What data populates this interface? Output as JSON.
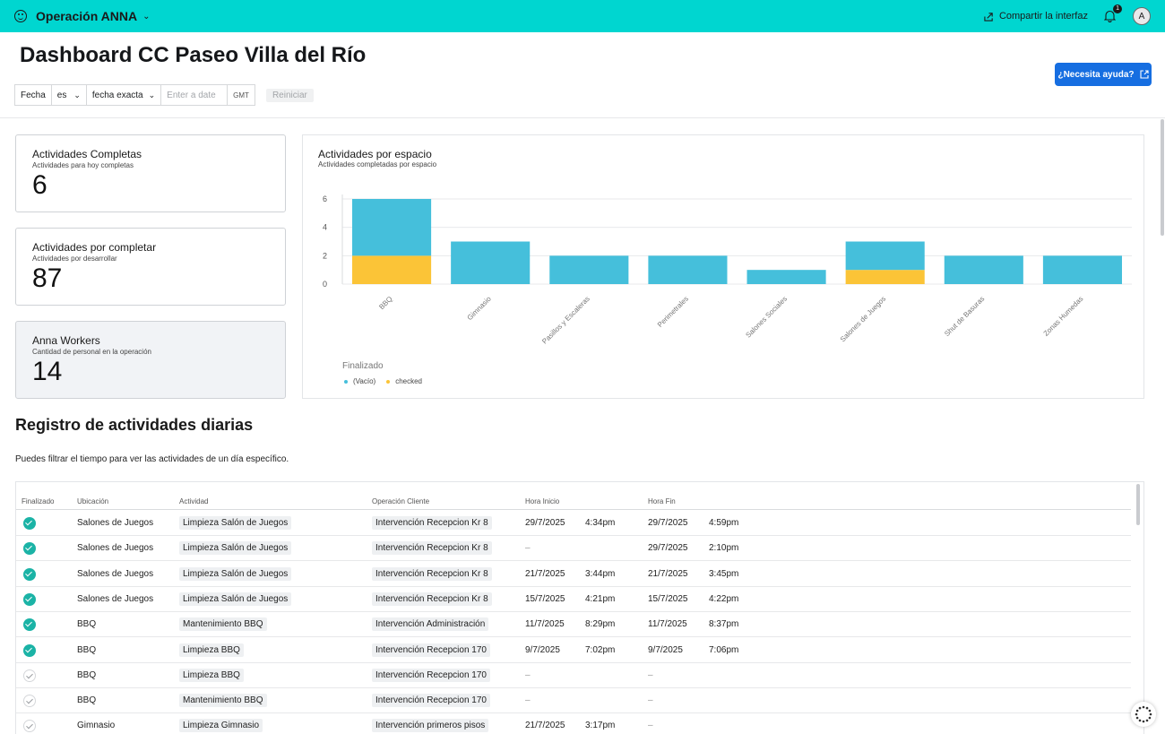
{
  "topbar": {
    "app_name": "Operación ANNA",
    "share_label": "Compartir la interfaz",
    "notification_count": "1",
    "avatar_initial": "A",
    "bg_color": "#00d6d0"
  },
  "page": {
    "title": "Dashboard CC Paseo Villa del Río",
    "help_label": "¿Necesita ayuda?"
  },
  "filters": {
    "field": "Fecha",
    "operator": "es",
    "mode": "fecha exacta",
    "date_placeholder": "Enter a date",
    "timezone": "GMT",
    "reset_label": "Reiniciar"
  },
  "kpis": [
    {
      "title": "Actividades Completas",
      "subtitle": "Actividades para hoy completas",
      "value": "6"
    },
    {
      "title": "Actividades por completar",
      "subtitle": "Actividades por desarrollar",
      "value": "87"
    },
    {
      "title": "Anna Workers",
      "subtitle": "Cantidad de personal en la operación",
      "value": "14"
    }
  ],
  "chart_data": {
    "type": "bar",
    "title": "Actividades por espacio",
    "subtitle": "Actividades completadas por espacio",
    "categories": [
      "BBQ",
      "Gimnasio",
      "Pasillos y Escaleras",
      "Perimetrales",
      "Salones Sociales",
      "Salones de Juegos",
      "Shut de Basuras",
      "Zonas Humedas"
    ],
    "series": [
      {
        "name": "checked",
        "color": "#fbc437",
        "values": [
          2,
          0,
          0,
          0,
          0,
          1,
          0,
          0
        ]
      },
      {
        "name": "(Vacío)",
        "color": "#45bfdb",
        "values": [
          4,
          3,
          2,
          2,
          1,
          2,
          2,
          2
        ]
      }
    ],
    "stacked": true,
    "yticks": [
      "0",
      "2",
      "4",
      "6"
    ],
    "ylim": [
      0,
      6
    ],
    "legend_title": "Finalizado",
    "legend_placement": "bottom-left",
    "grid": true
  },
  "table_section": {
    "title": "Registro de actividades diarias",
    "description": "Puedes filtrar el tiempo para ver las actividades de un día específico.",
    "columns": [
      "Finalizado",
      "Ubicación",
      "Actividad",
      "Operación Cliente",
      "Hora Inicio",
      "Hora Fin"
    ],
    "rows": [
      {
        "done": true,
        "location": "Salones de Juegos",
        "activity": "Limpieza Salón de Juegos",
        "operation": "Intervención Recepcion Kr 8",
        "start_date": "29/7/2025",
        "start_time": "4:34pm",
        "end_date": "29/7/2025",
        "end_time": "4:59pm"
      },
      {
        "done": true,
        "location": "Salones de Juegos",
        "activity": "Limpieza Salón de Juegos",
        "operation": "Intervención Recepcion Kr 8",
        "start_date": "–",
        "start_time": "",
        "end_date": "29/7/2025",
        "end_time": "2:10pm"
      },
      {
        "done": true,
        "location": "Salones de Juegos",
        "activity": "Limpieza Salón de Juegos",
        "operation": "Intervención Recepcion Kr 8",
        "start_date": "21/7/2025",
        "start_time": "3:44pm",
        "end_date": "21/7/2025",
        "end_time": "3:45pm"
      },
      {
        "done": true,
        "location": "Salones de Juegos",
        "activity": "Limpieza Salón de Juegos",
        "operation": "Intervención Recepcion Kr 8",
        "start_date": "15/7/2025",
        "start_time": "4:21pm",
        "end_date": "15/7/2025",
        "end_time": "4:22pm"
      },
      {
        "done": true,
        "location": "BBQ",
        "activity": "Mantenimiento BBQ",
        "operation": "Intervención Administración",
        "start_date": "11/7/2025",
        "start_time": "8:29pm",
        "end_date": "11/7/2025",
        "end_time": "8:37pm"
      },
      {
        "done": true,
        "location": "BBQ",
        "activity": "Limpieza BBQ",
        "operation": "Intervención Recepcion 170",
        "start_date": "9/7/2025",
        "start_time": "7:02pm",
        "end_date": "9/7/2025",
        "end_time": "7:06pm"
      },
      {
        "done": false,
        "location": "BBQ",
        "activity": "Limpieza BBQ",
        "operation": "Intervención Recepcion 170",
        "start_date": "–",
        "start_time": "",
        "end_date": "–",
        "end_time": ""
      },
      {
        "done": false,
        "location": "BBQ",
        "activity": "Mantenimiento BBQ",
        "operation": "Intervención Recepcion 170",
        "start_date": "–",
        "start_time": "",
        "end_date": "–",
        "end_time": ""
      },
      {
        "done": false,
        "location": "Gimnasio",
        "activity": "Limpieza Gimnasio",
        "operation": "Intervención primeros pisos",
        "start_date": "21/7/2025",
        "start_time": "3:17pm",
        "end_date": "–",
        "end_time": ""
      }
    ]
  }
}
